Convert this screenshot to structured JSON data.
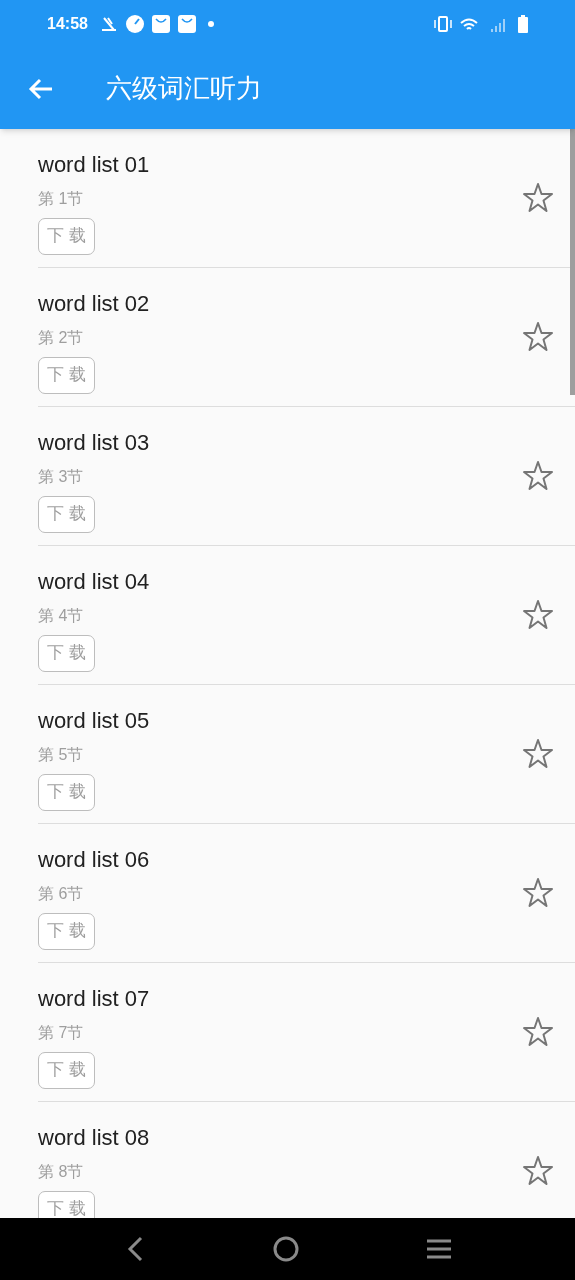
{
  "status_bar": {
    "time": "14:58"
  },
  "app_bar": {
    "title": "六级词汇听力"
  },
  "items": [
    {
      "title": "word list 01",
      "subtitle": "第 1节",
      "button": "下 载",
      "starred": false
    },
    {
      "title": "word list 02",
      "subtitle": "第 2节",
      "button": "下 载",
      "starred": false
    },
    {
      "title": "word list 03",
      "subtitle": "第 3节",
      "button": "下 载",
      "starred": false
    },
    {
      "title": "word list 04",
      "subtitle": "第 4节",
      "button": "下 载",
      "starred": false
    },
    {
      "title": "word list 05",
      "subtitle": "第 5节",
      "button": "下 载",
      "starred": false
    },
    {
      "title": "word list 06",
      "subtitle": "第 6节",
      "button": "下 载",
      "starred": false
    },
    {
      "title": "word list 07",
      "subtitle": "第 7节",
      "button": "下 载",
      "starred": false
    },
    {
      "title": "word list 08",
      "subtitle": "第 8节",
      "button": "下 载",
      "starred": false
    }
  ]
}
